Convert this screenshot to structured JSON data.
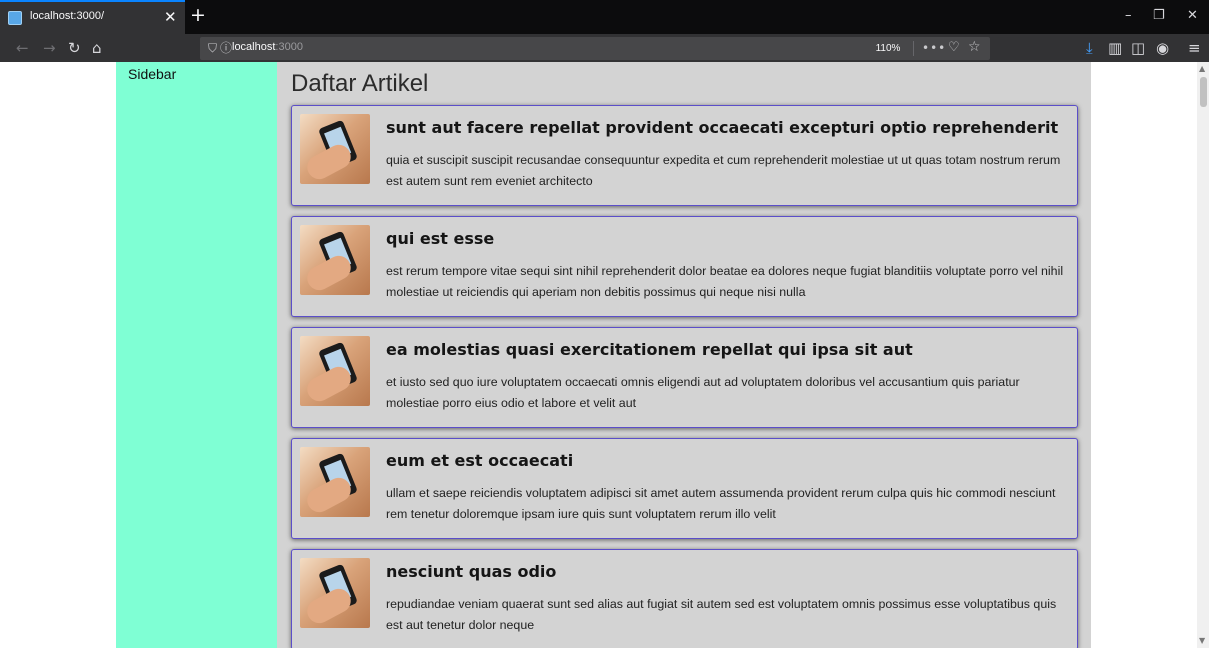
{
  "browser": {
    "tab": {
      "title": "localhost:3000/",
      "close_glyph": "✕",
      "favicon": "react-icon"
    },
    "new_tab_glyph": "+",
    "window_controls": {
      "minimize": "–",
      "restore": "❐",
      "close": "✕"
    },
    "nav": {
      "back": "←",
      "forward": "→",
      "reload": "↻",
      "home": "⌂"
    },
    "url": {
      "host_bold": "localhost",
      "rest": ":3000",
      "shield": "⛉",
      "info": "ⓘ"
    },
    "zoom": "110%",
    "url_actions": {
      "more": "•••",
      "pocket": "♡",
      "bookmark": "☆"
    },
    "toolbar": {
      "download": "⤓",
      "library": "▥",
      "sidebar_toggle": "◫",
      "account": "◉",
      "menu": "≡"
    },
    "colors": {
      "accent": "#0a84ff",
      "download": "#45a1ff"
    }
  },
  "sidebar": {
    "title": "Sidebar",
    "color": "#7fffd4"
  },
  "main": {
    "title": "Daftar Artikel",
    "articles": [
      {
        "title": "sunt aut facere repellat provident occaecati excepturi optio reprehenderit",
        "body": "quia et suscipit suscipit recusandae consequuntur expedita et cum reprehenderit molestiae ut ut quas totam nostrum rerum est autem sunt rem eveniet architecto"
      },
      {
        "title": "qui est esse",
        "body": "est rerum tempore vitae sequi sint nihil reprehenderit dolor beatae ea dolores neque fugiat blanditiis voluptate porro vel nihil molestiae ut reiciendis qui aperiam non debitis possimus qui neque nisi nulla"
      },
      {
        "title": "ea molestias quasi exercitationem repellat qui ipsa sit aut",
        "body": "et iusto sed quo iure voluptatem occaecati omnis eligendi aut ad voluptatem doloribus vel accusantium quis pariatur molestiae porro eius odio et labore et velit aut"
      },
      {
        "title": "eum et est occaecati",
        "body": "ullam et saepe reiciendis voluptatem adipisci sit amet autem assumenda provident rerum culpa quis hic commodi nesciunt rem tenetur doloremque ipsam iure quis sunt voluptatem rerum illo velit"
      },
      {
        "title": "nesciunt quas odio",
        "body": "repudiandae veniam quaerat sunt sed alias aut fugiat sit autem sed est voluptatem omnis possimus esse voluptatibus quis est aut tenetur dolor neque"
      }
    ]
  }
}
